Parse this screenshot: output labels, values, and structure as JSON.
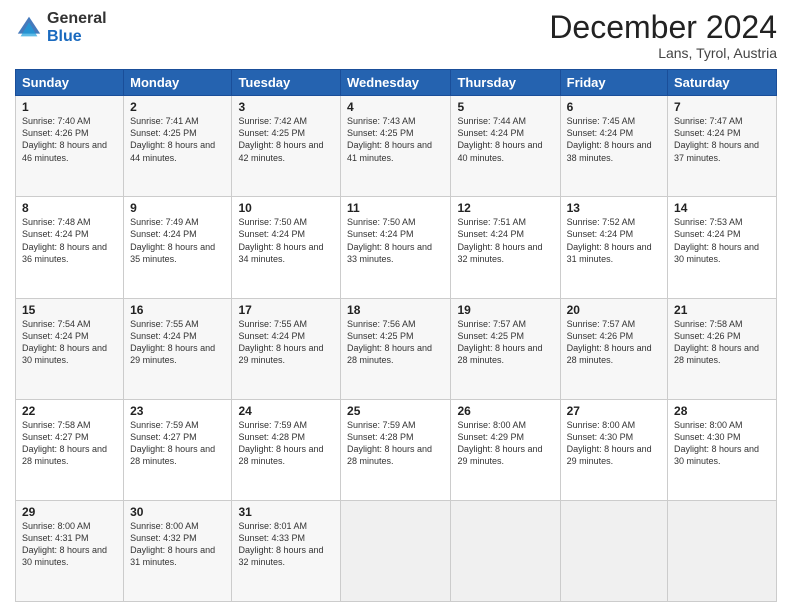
{
  "logo": {
    "general": "General",
    "blue": "Blue"
  },
  "header": {
    "title": "December 2024",
    "location": "Lans, Tyrol, Austria"
  },
  "days_of_week": [
    "Sunday",
    "Monday",
    "Tuesday",
    "Wednesday",
    "Thursday",
    "Friday",
    "Saturday"
  ],
  "weeks": [
    [
      {
        "day": "1",
        "sunrise": "Sunrise: 7:40 AM",
        "sunset": "Sunset: 4:26 PM",
        "daylight": "Daylight: 8 hours and 46 minutes."
      },
      {
        "day": "2",
        "sunrise": "Sunrise: 7:41 AM",
        "sunset": "Sunset: 4:25 PM",
        "daylight": "Daylight: 8 hours and 44 minutes."
      },
      {
        "day": "3",
        "sunrise": "Sunrise: 7:42 AM",
        "sunset": "Sunset: 4:25 PM",
        "daylight": "Daylight: 8 hours and 42 minutes."
      },
      {
        "day": "4",
        "sunrise": "Sunrise: 7:43 AM",
        "sunset": "Sunset: 4:25 PM",
        "daylight": "Daylight: 8 hours and 41 minutes."
      },
      {
        "day": "5",
        "sunrise": "Sunrise: 7:44 AM",
        "sunset": "Sunset: 4:24 PM",
        "daylight": "Daylight: 8 hours and 40 minutes."
      },
      {
        "day": "6",
        "sunrise": "Sunrise: 7:45 AM",
        "sunset": "Sunset: 4:24 PM",
        "daylight": "Daylight: 8 hours and 38 minutes."
      },
      {
        "day": "7",
        "sunrise": "Sunrise: 7:47 AM",
        "sunset": "Sunset: 4:24 PM",
        "daylight": "Daylight: 8 hours and 37 minutes."
      }
    ],
    [
      {
        "day": "8",
        "sunrise": "Sunrise: 7:48 AM",
        "sunset": "Sunset: 4:24 PM",
        "daylight": "Daylight: 8 hours and 36 minutes."
      },
      {
        "day": "9",
        "sunrise": "Sunrise: 7:49 AM",
        "sunset": "Sunset: 4:24 PM",
        "daylight": "Daylight: 8 hours and 35 minutes."
      },
      {
        "day": "10",
        "sunrise": "Sunrise: 7:50 AM",
        "sunset": "Sunset: 4:24 PM",
        "daylight": "Daylight: 8 hours and 34 minutes."
      },
      {
        "day": "11",
        "sunrise": "Sunrise: 7:50 AM",
        "sunset": "Sunset: 4:24 PM",
        "daylight": "Daylight: 8 hours and 33 minutes."
      },
      {
        "day": "12",
        "sunrise": "Sunrise: 7:51 AM",
        "sunset": "Sunset: 4:24 PM",
        "daylight": "Daylight: 8 hours and 32 minutes."
      },
      {
        "day": "13",
        "sunrise": "Sunrise: 7:52 AM",
        "sunset": "Sunset: 4:24 PM",
        "daylight": "Daylight: 8 hours and 31 minutes."
      },
      {
        "day": "14",
        "sunrise": "Sunrise: 7:53 AM",
        "sunset": "Sunset: 4:24 PM",
        "daylight": "Daylight: 8 hours and 30 minutes."
      }
    ],
    [
      {
        "day": "15",
        "sunrise": "Sunrise: 7:54 AM",
        "sunset": "Sunset: 4:24 PM",
        "daylight": "Daylight: 8 hours and 30 minutes."
      },
      {
        "day": "16",
        "sunrise": "Sunrise: 7:55 AM",
        "sunset": "Sunset: 4:24 PM",
        "daylight": "Daylight: 8 hours and 29 minutes."
      },
      {
        "day": "17",
        "sunrise": "Sunrise: 7:55 AM",
        "sunset": "Sunset: 4:24 PM",
        "daylight": "Daylight: 8 hours and 29 minutes."
      },
      {
        "day": "18",
        "sunrise": "Sunrise: 7:56 AM",
        "sunset": "Sunset: 4:25 PM",
        "daylight": "Daylight: 8 hours and 28 minutes."
      },
      {
        "day": "19",
        "sunrise": "Sunrise: 7:57 AM",
        "sunset": "Sunset: 4:25 PM",
        "daylight": "Daylight: 8 hours and 28 minutes."
      },
      {
        "day": "20",
        "sunrise": "Sunrise: 7:57 AM",
        "sunset": "Sunset: 4:26 PM",
        "daylight": "Daylight: 8 hours and 28 minutes."
      },
      {
        "day": "21",
        "sunrise": "Sunrise: 7:58 AM",
        "sunset": "Sunset: 4:26 PM",
        "daylight": "Daylight: 8 hours and 28 minutes."
      }
    ],
    [
      {
        "day": "22",
        "sunrise": "Sunrise: 7:58 AM",
        "sunset": "Sunset: 4:27 PM",
        "daylight": "Daylight: 8 hours and 28 minutes."
      },
      {
        "day": "23",
        "sunrise": "Sunrise: 7:59 AM",
        "sunset": "Sunset: 4:27 PM",
        "daylight": "Daylight: 8 hours and 28 minutes."
      },
      {
        "day": "24",
        "sunrise": "Sunrise: 7:59 AM",
        "sunset": "Sunset: 4:28 PM",
        "daylight": "Daylight: 8 hours and 28 minutes."
      },
      {
        "day": "25",
        "sunrise": "Sunrise: 7:59 AM",
        "sunset": "Sunset: 4:28 PM",
        "daylight": "Daylight: 8 hours and 28 minutes."
      },
      {
        "day": "26",
        "sunrise": "Sunrise: 8:00 AM",
        "sunset": "Sunset: 4:29 PM",
        "daylight": "Daylight: 8 hours and 29 minutes."
      },
      {
        "day": "27",
        "sunrise": "Sunrise: 8:00 AM",
        "sunset": "Sunset: 4:30 PM",
        "daylight": "Daylight: 8 hours and 29 minutes."
      },
      {
        "day": "28",
        "sunrise": "Sunrise: 8:00 AM",
        "sunset": "Sunset: 4:30 PM",
        "daylight": "Daylight: 8 hours and 30 minutes."
      }
    ],
    [
      {
        "day": "29",
        "sunrise": "Sunrise: 8:00 AM",
        "sunset": "Sunset: 4:31 PM",
        "daylight": "Daylight: 8 hours and 30 minutes."
      },
      {
        "day": "30",
        "sunrise": "Sunrise: 8:00 AM",
        "sunset": "Sunset: 4:32 PM",
        "daylight": "Daylight: 8 hours and 31 minutes."
      },
      {
        "day": "31",
        "sunrise": "Sunrise: 8:01 AM",
        "sunset": "Sunset: 4:33 PM",
        "daylight": "Daylight: 8 hours and 32 minutes."
      },
      null,
      null,
      null,
      null
    ]
  ]
}
